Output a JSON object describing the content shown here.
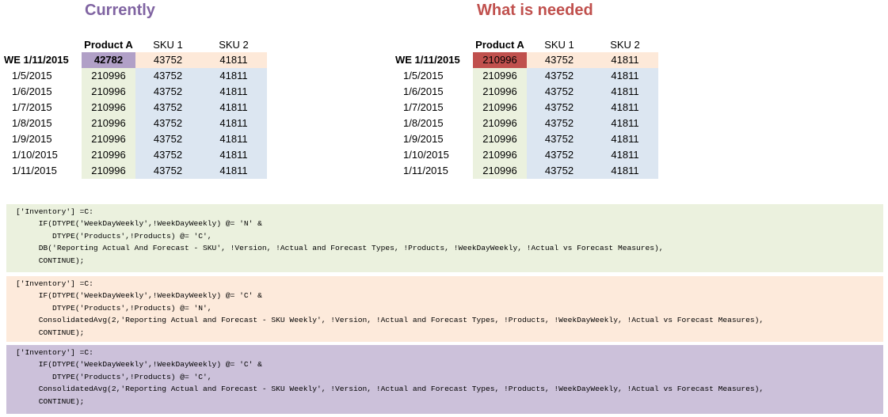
{
  "currently": {
    "title": "Currently",
    "header": [
      "",
      "Product A",
      "SKU 1",
      "SKU 2"
    ],
    "week_row": [
      "WE 1/11/2015",
      "42782",
      "43752",
      "41811"
    ],
    "rows": [
      [
        "1/5/2015",
        "210996",
        "43752",
        "41811"
      ],
      [
        "1/6/2015",
        "210996",
        "43752",
        "41811"
      ],
      [
        "1/7/2015",
        "210996",
        "43752",
        "41811"
      ],
      [
        "1/8/2015",
        "210996",
        "43752",
        "41811"
      ],
      [
        "1/9/2015",
        "210996",
        "43752",
        "41811"
      ],
      [
        "1/10/2015",
        "210996",
        "43752",
        "41811"
      ],
      [
        "1/11/2015",
        "210996",
        "43752",
        "41811"
      ]
    ]
  },
  "needed": {
    "title": "What is needed",
    "header": [
      "",
      "Product A",
      "SKU 1",
      "SKU 2"
    ],
    "week_row": [
      "WE 1/11/2015",
      "210996",
      "43752",
      "41811"
    ],
    "rows": [
      [
        "1/5/2015",
        "210996",
        "43752",
        "41811"
      ],
      [
        "1/6/2015",
        "210996",
        "43752",
        "41811"
      ],
      [
        "1/7/2015",
        "210996",
        "43752",
        "41811"
      ],
      [
        "1/8/2015",
        "210996",
        "43752",
        "41811"
      ],
      [
        "1/9/2015",
        "210996",
        "43752",
        "41811"
      ],
      [
        "1/10/2015",
        "210996",
        "43752",
        "41811"
      ],
      [
        "1/11/2015",
        "210996",
        "43752",
        "41811"
      ]
    ]
  },
  "code_blocks": [
    [
      "['Inventory'] =C:",
      "     IF(DTYPE('WeekDayWeekly',!WeekDayWeekly) @= 'N' &",
      "        DTYPE('Products',!Products) @= 'C',",
      "     DB('Reporting Actual And Forecast - SKU', !Version, !Actual and Forecast Types, !Products, !WeekDayWeekly, !Actual vs Forecast Measures),",
      "     CONTINUE);"
    ],
    [
      "['Inventory'] =C:",
      "     IF(DTYPE('WeekDayWeekly',!WeekDayWeekly) @= 'C' &",
      "        DTYPE('Products',!Products) @= 'N',",
      "     ConsolidatedAvg(2,'Reporting Actual and Forecast - SKU Weekly', !Version, !Actual and Forecast Types, !Products, !WeekDayWeekly, !Actual vs Forecast Measures),",
      "     CONTINUE);"
    ],
    [
      "['Inventory'] =C:",
      "     IF(DTYPE('WeekDayWeekly',!WeekDayWeekly) @= 'C' &",
      "        DTYPE('Products',!Products) @= 'C',",
      "     ConsolidatedAvg(2,'Reporting Actual and Forecast - SKU Weekly', !Version, !Actual and Forecast Types, !Products, !WeekDayWeekly, !Actual vs Forecast Measures),",
      "     CONTINUE);"
    ]
  ]
}
